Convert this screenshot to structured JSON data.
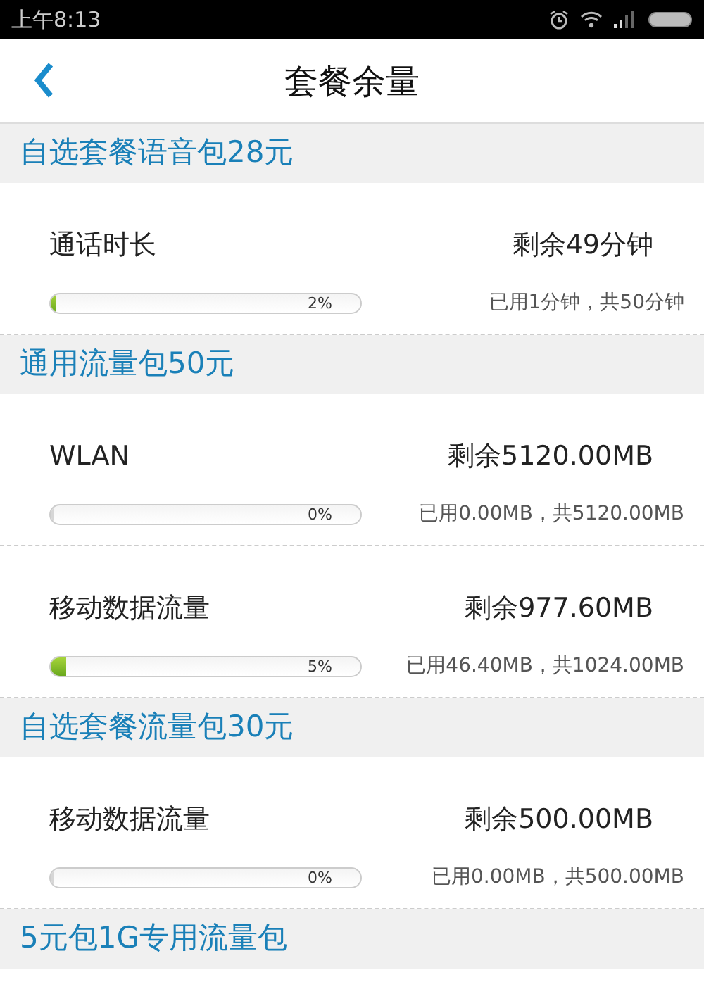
{
  "status_bar": {
    "time": "上午8:13"
  },
  "header": {
    "title": "套餐余量"
  },
  "packages": [
    {
      "name": "自选套餐语音包28元",
      "items": [
        {
          "name": "通话时长",
          "remaining": "剩余49分钟",
          "level": 0.02,
          "percent": "2%",
          "usage": "已用1分钟，共50分钟"
        }
      ]
    },
    {
      "name": "通用流量包50元",
      "items": [
        {
          "name": "WLAN",
          "remaining": "剩余5120.00MB",
          "level": 0,
          "percent": "0%",
          "usage": "已用0.00MB，共5120.00MB"
        },
        {
          "name": "移动数据流量",
          "remaining": "剩余977.60MB",
          "level": 0.05,
          "percent": "5%",
          "usage": "已用46.40MB，共1024.00MB"
        }
      ]
    },
    {
      "name": "自选套餐流量包30元",
      "items": [
        {
          "name": "移动数据流量",
          "remaining": "剩余500.00MB",
          "level": 0,
          "percent": "0%",
          "usage": "已用0.00MB，共500.00MB"
        }
      ]
    },
    {
      "name": "5元包1G专用流量包"
    }
  ]
}
